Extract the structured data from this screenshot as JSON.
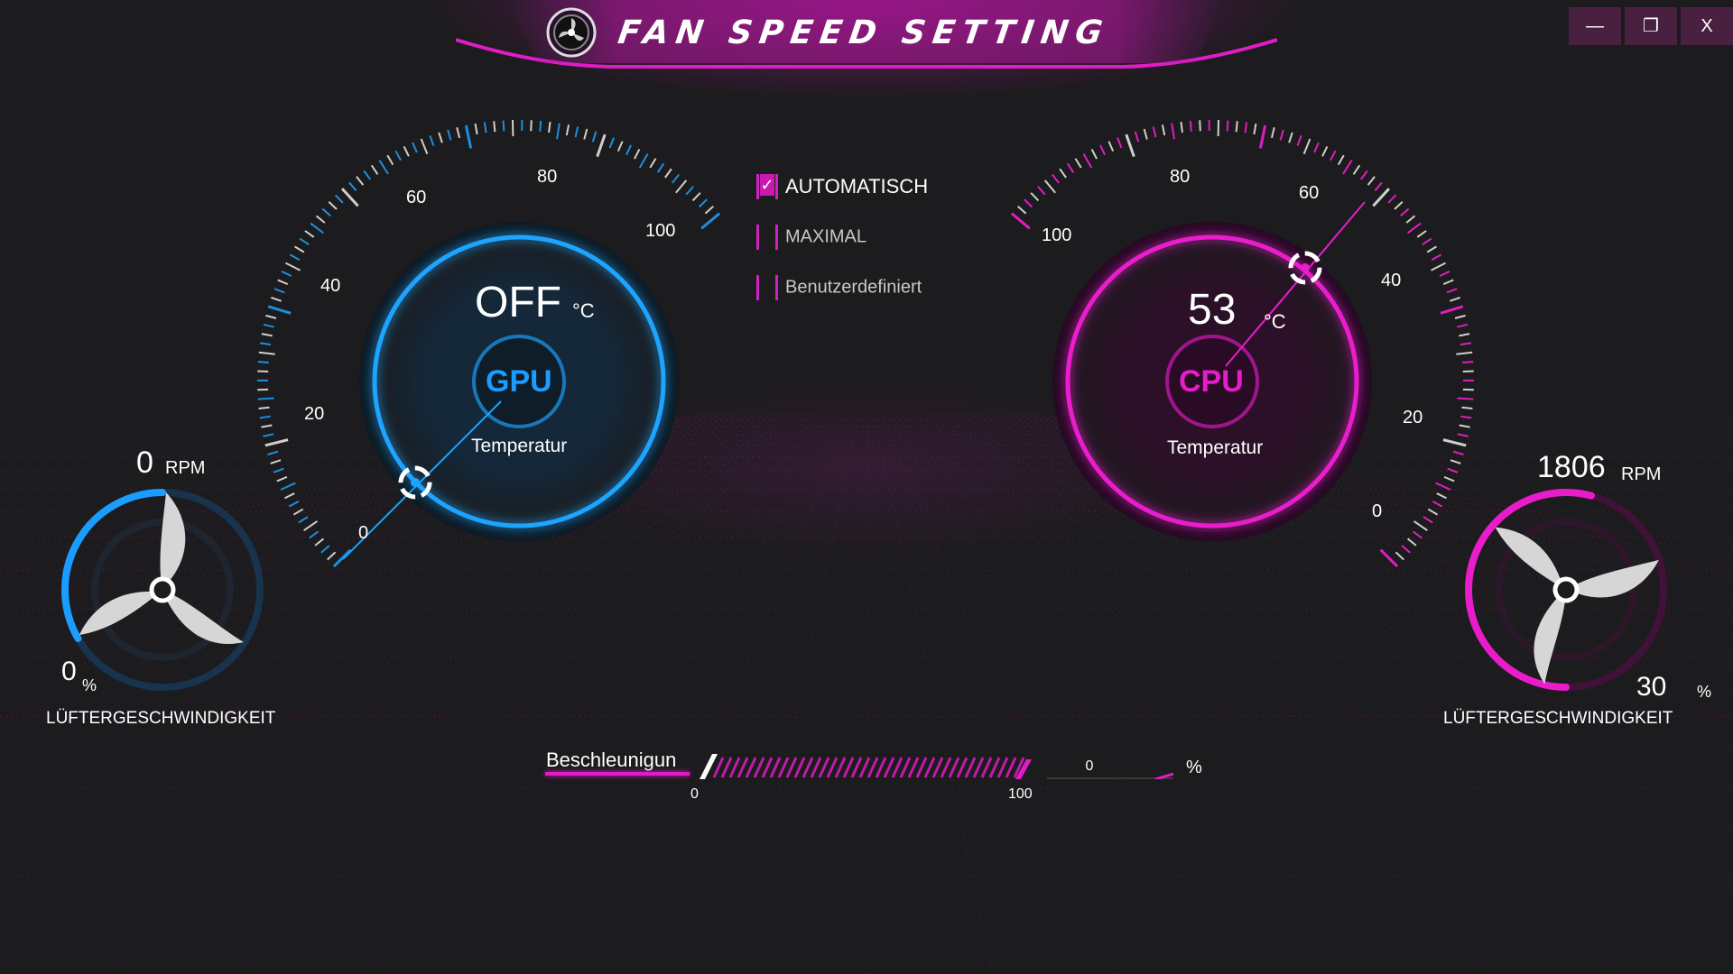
{
  "window": {
    "title": "Fan Speed Setting",
    "buttons": {
      "minimize": "—",
      "restore": "❐",
      "close": "X"
    }
  },
  "gpu": {
    "chip_label": "GPU",
    "temperature_value": "OFF",
    "temperature_unit": "°C",
    "temperature_label": "Temperatur",
    "scale_labels": [
      "0",
      "20",
      "40",
      "60",
      "80",
      "100"
    ],
    "fan": {
      "rpm_value": "0",
      "rpm_unit": "RPM",
      "percent_value": "0",
      "percent_unit": "%",
      "label": "LÜFTERGESCHWINDIGKEIT",
      "speed_fraction": 0.0
    },
    "accent_color": "#1a9fff"
  },
  "cpu": {
    "chip_label": "CPU",
    "temperature_value": "53",
    "temperature_unit": "°C",
    "temperature_label": "Temperatur",
    "scale_labels": [
      "0",
      "20",
      "40",
      "60",
      "80",
      "100"
    ],
    "fan": {
      "rpm_value": "1806",
      "rpm_unit": "RPM",
      "percent_value": "30",
      "percent_unit": "%",
      "label": "LÜFTERGESCHWINDIGKEIT",
      "speed_fraction": 0.3
    },
    "accent_color": "#e81cc9"
  },
  "modes": [
    {
      "label": "AUTOMATISCH",
      "checked": true
    },
    {
      "label": "MAXIMAL",
      "checked": false
    },
    {
      "label": "Benutzerdefiniert",
      "checked": false
    }
  ],
  "acceleration": {
    "label": "Beschleunigun",
    "min_label": "0",
    "max_label": "100",
    "value": "0",
    "unit": "%"
  }
}
